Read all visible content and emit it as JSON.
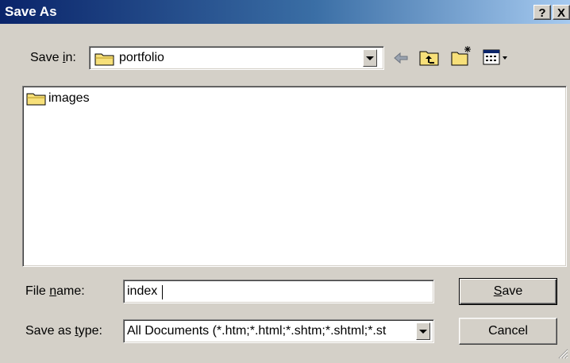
{
  "window": {
    "title": "Save As",
    "help_label": "?",
    "close_label": "X"
  },
  "toolbar": {
    "save_in_prefix": "Save ",
    "save_in_mnemonic": "i",
    "save_in_suffix": "n:",
    "location": "portfolio",
    "location_icon": "folder-icon",
    "back_icon": "back-arrow-icon",
    "up_icon": "up-one-level-icon",
    "new_folder_icon": "new-folder-icon",
    "views_icon": "views-menu-icon"
  },
  "file_list": {
    "items": [
      {
        "name": "images",
        "icon": "folder-icon"
      }
    ]
  },
  "filename": {
    "label_prefix": "File ",
    "label_mnemonic": "n",
    "label_suffix": "ame:",
    "value": "index"
  },
  "filetype": {
    "label_prefix": "Save as ",
    "label_mnemonic": "t",
    "label_suffix": "ype:",
    "value": "All Documents (*.htm;*.html;*.shtm;*.shtml;*.st"
  },
  "buttons": {
    "save_mnemonic": "S",
    "save_rest": "ave",
    "cancel": "Cancel"
  },
  "colors": {
    "title_start": "#0a246a",
    "title_end": "#a6caf0",
    "dialog_face": "#d4d0c8",
    "folder_yellow": "#f7e07a"
  }
}
